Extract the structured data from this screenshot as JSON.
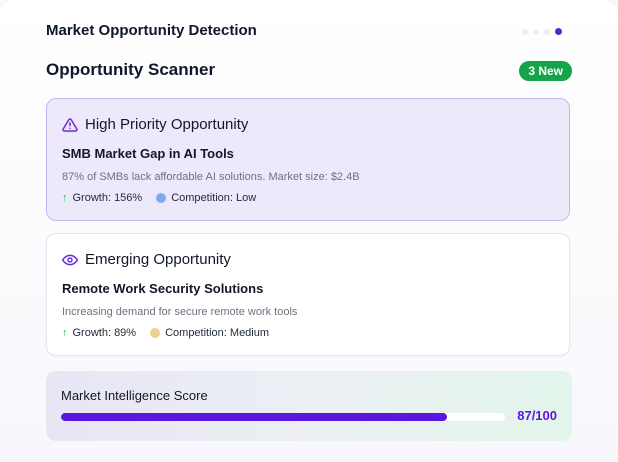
{
  "header": {
    "title": "Market Opportunity Detection"
  },
  "carousel": {
    "dots": 4,
    "active_index": 3,
    "active_color": "#5b21d6"
  },
  "scanner": {
    "title": "Opportunity Scanner",
    "badge": "3 New",
    "badge_color": "#16a34a"
  },
  "opportunities": [
    {
      "icon": "warning-triangle-icon",
      "heading": "High Priority Opportunity",
      "subtitle": "SMB Market Gap in AI Tools",
      "description": "87% of SMBs lack affordable AI solutions. Market size: $2.4B",
      "growth": "Growth: 156%",
      "competition": "Competition: Low",
      "competition_color": "#7fa9ee"
    },
    {
      "icon": "eye-icon",
      "heading": "Emerging Opportunity",
      "subtitle": "Remote Work Security Solutions",
      "description": "Increasing demand for secure remote work tools",
      "growth": "Growth: 89%",
      "competition": "Competition: Medium",
      "competition_color": "#f2cf8e"
    }
  ],
  "score": {
    "title": "Market Intelligence Score",
    "value": 87,
    "max": 100,
    "display": "87/100",
    "color": "#5b16e0"
  }
}
